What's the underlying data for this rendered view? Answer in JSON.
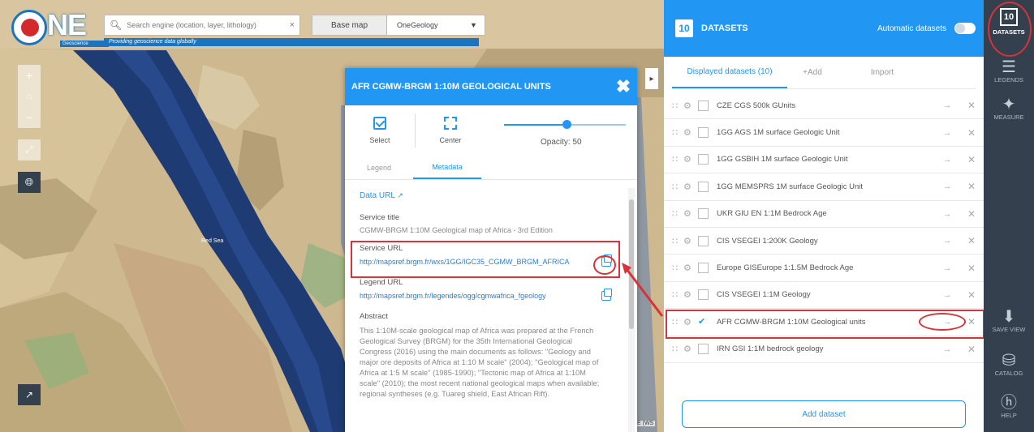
{
  "app": {
    "logo_text": "NE",
    "logo_subtitle": "Geoscience",
    "tagline": "Providing geoscience data globally"
  },
  "search": {
    "placeholder": "Search engine (location, layer, lithology)"
  },
  "basemap": {
    "label": "Base map",
    "value": "OneGeology"
  },
  "map": {
    "sea_label": "Red Sea",
    "attribution": "E (WS"
  },
  "popup": {
    "title": "AFR CGMW-BRGM 1:10M GEOLOGICAL UNITS",
    "select_label": "Select",
    "center_label": "Center",
    "opacity_label": "Opacity: 50",
    "opacity_value": 50,
    "tabs": [
      "Legend",
      "Metadata"
    ],
    "active_tab": "Metadata",
    "data_url_label": "Data URL",
    "service_title_label": "Service title",
    "service_title": "CGMW-BRGM 1:10M Geological map of Africa - 3rd Edition",
    "service_url_label": "Service URL",
    "service_url": "http://mapsref.brgm.fr/wxs/1GG/IGC35_CGMW_BRGM_AFRICA",
    "legend_url_label": "Legend URL",
    "legend_url": "http://mapsref.brgm.fr/legendes/ogg/cgmwafrica_fgeology",
    "abstract_label": "Abstract",
    "abstract": "This 1:10M-scale geological map of Africa was prepared at the French Geological Survey (BRGM) for the 35th International Geological Congress (2016) using the main documents as follows: \"Geology and major ore deposits of Africa at 1:10 M scale\" (2004); \"Geological map of Africa at 1:5 M scale\" (1985-1990); \"Tectonic map of Africa at 1:10M scale\" (2010); the most recent national geological maps when available; regional syntheses (e.g. Tuareg shield, East African Rift)."
  },
  "datasets": {
    "count": "10",
    "title": "DATASETS",
    "automatic_label": "Automatic datasets",
    "tabs": [
      "Displayed datasets (10)",
      "+Add",
      "Import"
    ],
    "items": [
      {
        "name": "CZE CGS 500k GUnits",
        "checked": false
      },
      {
        "name": "1GG AGS 1M surface Geologic Unit",
        "checked": false
      },
      {
        "name": "1GG GSBIH 1M surface Geologic Unit",
        "checked": false
      },
      {
        "name": "1GG MEMSPRS 1M surface Geologic Unit",
        "checked": false
      },
      {
        "name": "UKR GIU EN 1:1M Bedrock Age",
        "checked": false
      },
      {
        "name": "CIS VSEGEI 1:200K Geology",
        "checked": false
      },
      {
        "name": "Europe GISEurope 1:1.5M Bedrock Age",
        "checked": false
      },
      {
        "name": "CIS VSEGEI 1:1M Geology",
        "checked": false
      },
      {
        "name": "AFR CGMW-BRGM 1:10M Geological units",
        "checked": true
      },
      {
        "name": "IRN GSI 1:1M bedrock geology",
        "checked": false
      }
    ],
    "add_button": "Add dataset"
  },
  "sidebar": {
    "datasets_count": "10",
    "items": [
      "DATASETS",
      "LEGENDS",
      "MEASURE",
      "SAVE VIEW",
      "CATALOG",
      "HELP"
    ]
  },
  "colors": {
    "accent": "#2196f3",
    "sidebar": "#34404e",
    "highlight": "#d6333a"
  }
}
